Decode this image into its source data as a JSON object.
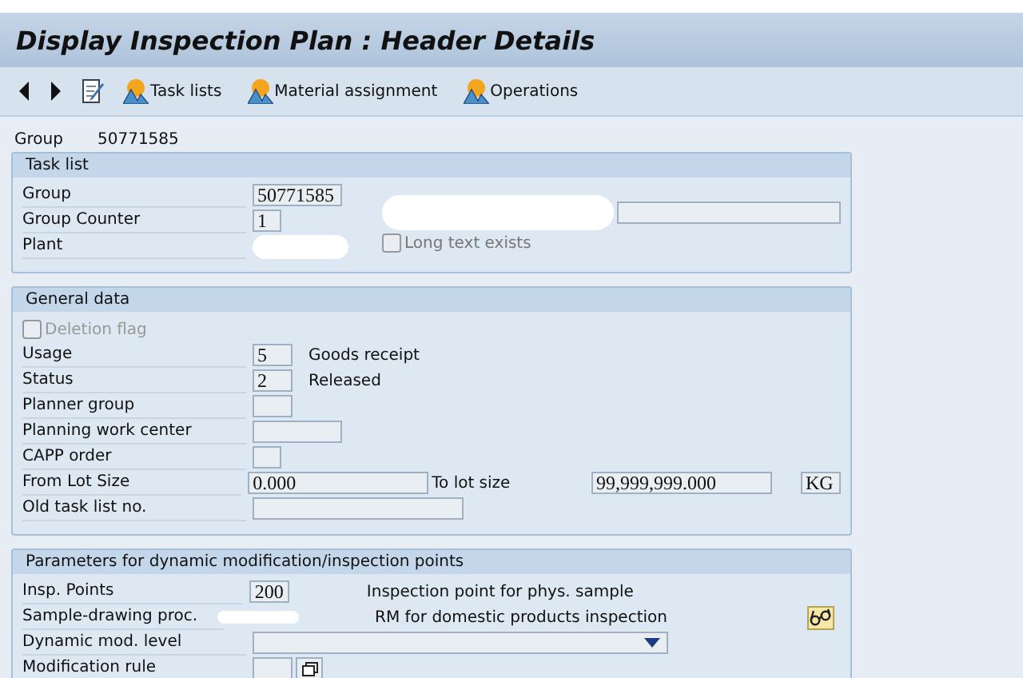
{
  "window": {
    "title": "Display Inspection Plan : Header Details"
  },
  "toolbar": {
    "buttons": [
      {
        "kind": "back"
      },
      {
        "kind": "forward"
      },
      {
        "kind": "edit"
      },
      {
        "kind": "mountain",
        "label": "Task lists"
      },
      {
        "kind": "mountain",
        "label": "Material assignment"
      },
      {
        "kind": "mountain",
        "label": "Operations"
      }
    ]
  },
  "header": {
    "label": "Group",
    "value": "50771585"
  },
  "task_list": {
    "title": "Task list",
    "rows": [
      {
        "label": "Group",
        "value": "50771585"
      },
      {
        "label": "Group Counter",
        "value": "1"
      },
      {
        "label": "Plant"
      }
    ],
    "checkbox": {
      "label": "Long text exists",
      "checked": false
    }
  },
  "general_data": {
    "title": "General data",
    "deletion_flag": {
      "label": "Deletion flag",
      "checked": false,
      "disabled": true
    },
    "rows": [
      {
        "label": "Usage",
        "value": "5",
        "description": "Goods receipt"
      },
      {
        "label": "Status",
        "value": "2",
        "description": "Released"
      },
      {
        "label": "Planner group",
        "value": ""
      },
      {
        "label": "Planning work center",
        "value": ""
      },
      {
        "label": "CAPP order",
        "value": ""
      },
      {
        "label": "From Lot Size",
        "value": "0.000",
        "to_label": "To lot size",
        "to_value": "99,999,999.000",
        "unit": "KG"
      },
      {
        "label": "Old task list no.",
        "value": ""
      }
    ]
  },
  "parameters": {
    "title": "Parameters for dynamic modification/inspection points",
    "rows": [
      {
        "label": "Insp. Points",
        "kind": "text",
        "value": "200",
        "description": "Inspection point for phys. sample"
      },
      {
        "label": "Sample-drawing proc.",
        "kind": "text",
        "value": "",
        "description": "RM for domestic products inspection"
      },
      {
        "label": "Dynamic mod. level",
        "kind": "dropdown",
        "value": ""
      },
      {
        "label": "Modification rule",
        "kind": "picker",
        "value": ""
      }
    ]
  }
}
